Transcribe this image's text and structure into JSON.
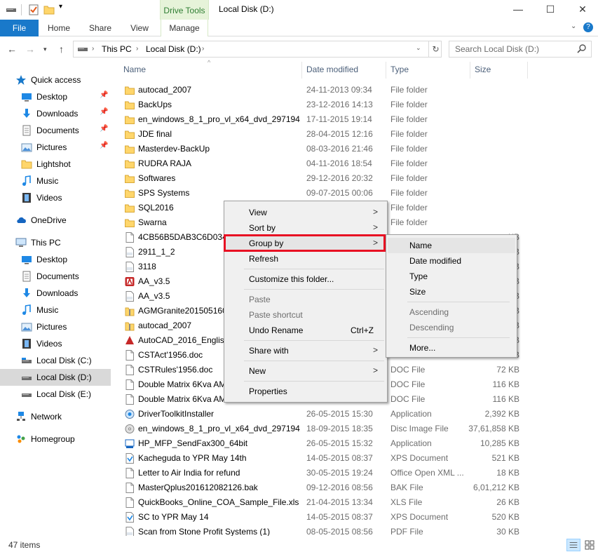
{
  "title_bar": {
    "contextual_tab": "Drive Tools",
    "window_title": "Local Disk (D:)",
    "minimize": "—",
    "maximize": "☐",
    "close": "✕"
  },
  "ribbon": {
    "tabs": [
      {
        "label": "File"
      },
      {
        "label": "Home"
      },
      {
        "label": "Share"
      },
      {
        "label": "View"
      },
      {
        "label": "Manage"
      }
    ],
    "help": "?"
  },
  "address_bar": {
    "crumbs": [
      "This PC",
      "Local Disk (D:)"
    ],
    "search_placeholder": "Search Local Disk (D:)"
  },
  "nav_pane": {
    "items": [
      {
        "label": "Quick access",
        "icon": "star-icon"
      },
      {
        "label": "Desktop",
        "icon": "desktop-icon",
        "pinned": true
      },
      {
        "label": "Downloads",
        "icon": "downloads-icon",
        "pinned": true
      },
      {
        "label": "Documents",
        "icon": "documents-icon",
        "pinned": true
      },
      {
        "label": "Pictures",
        "icon": "pictures-icon",
        "pinned": true
      },
      {
        "label": "Lightshot",
        "icon": "folder-icon"
      },
      {
        "label": "Music",
        "icon": "music-icon"
      },
      {
        "label": "Videos",
        "icon": "videos-icon"
      },
      {
        "label": "OneDrive",
        "icon": "cloud-icon"
      },
      {
        "label": "This PC",
        "icon": "computer-icon"
      },
      {
        "label": "Desktop",
        "icon": "desktop-icon"
      },
      {
        "label": "Documents",
        "icon": "documents-icon"
      },
      {
        "label": "Downloads",
        "icon": "downloads-icon"
      },
      {
        "label": "Music",
        "icon": "music-icon"
      },
      {
        "label": "Pictures",
        "icon": "pictures-icon"
      },
      {
        "label": "Videos",
        "icon": "videos-icon"
      },
      {
        "label": "Local Disk (C:)",
        "icon": "drive-icon"
      },
      {
        "label": "Local Disk (D:)",
        "icon": "drive-icon",
        "selected": true
      },
      {
        "label": "Local Disk (E:)",
        "icon": "drive-icon"
      },
      {
        "label": "Network",
        "icon": "network-icon"
      },
      {
        "label": "Homegroup",
        "icon": "homegroup-icon"
      }
    ]
  },
  "columns": {
    "name": "Name",
    "date": "Date modified",
    "type": "Type",
    "size": "Size"
  },
  "files": [
    {
      "name": "autocad_2007",
      "date": "24-11-2013 09:34",
      "type": "File folder",
      "size": "",
      "icon": "folder-icon"
    },
    {
      "name": "BackUps",
      "date": "23-12-2016 14:13",
      "type": "File folder",
      "size": "",
      "icon": "folder-icon"
    },
    {
      "name": "en_windows_8_1_pro_vl_x64_dvd_297194...",
      "date": "17-11-2015 19:14",
      "type": "File folder",
      "size": "",
      "icon": "folder-icon"
    },
    {
      "name": "JDE final",
      "date": "28-04-2015 12:16",
      "type": "File folder",
      "size": "",
      "icon": "folder-icon"
    },
    {
      "name": "Masterdev-BackUp",
      "date": "08-03-2016 21:46",
      "type": "File folder",
      "size": "",
      "icon": "folder-icon"
    },
    {
      "name": "RUDRA RAJA",
      "date": "04-11-2016 18:54",
      "type": "File folder",
      "size": "",
      "icon": "folder-icon"
    },
    {
      "name": "Softwares",
      "date": "29-12-2016 20:32",
      "type": "File folder",
      "size": "",
      "icon": "folder-icon"
    },
    {
      "name": "SPS Systems",
      "date": "09-07-2015 00:06",
      "type": "File folder",
      "size": "",
      "icon": "folder-icon"
    },
    {
      "name": "SQL2016",
      "date": "",
      "type": "File folder",
      "size": "",
      "icon": "folder-icon"
    },
    {
      "name": "Swarna",
      "date": "",
      "type": "File folder",
      "size": "",
      "icon": "folder-icon"
    },
    {
      "name": "4CB56B5DAB3C6D0340",
      "date": "",
      "type": "",
      "size": "KB",
      "icon": "file-icon"
    },
    {
      "name": "2911_1_2",
      "date": "",
      "type": "",
      "size": "KB",
      "icon": "pdf-icon"
    },
    {
      "name": "3118",
      "date": "",
      "type": "",
      "size": "KB",
      "icon": "pdf-icon"
    },
    {
      "name": "AA_v3.5",
      "date": "",
      "type": "",
      "size": "KB",
      "icon": "app-red-icon"
    },
    {
      "name": "AA_v3.5",
      "date": "",
      "type": "",
      "size": "KB",
      "icon": "pdf-icon"
    },
    {
      "name": "AGMGranite20150516001",
      "date": "",
      "type": "",
      "size": "KB",
      "icon": "zip-icon"
    },
    {
      "name": "autocad_2007",
      "date": "",
      "type": "",
      "size": "KB",
      "icon": "zip-icon"
    },
    {
      "name": "AutoCAD_2016_English_",
      "date": "",
      "type": "",
      "size": "KB",
      "icon": "autocad-icon"
    },
    {
      "name": "CSTAct'1956.doc",
      "date": "",
      "type": "",
      "size": "KB",
      "icon": "file-icon"
    },
    {
      "name": "CSTRules'1956.doc",
      "date": "",
      "type": "DOC File",
      "size": "72 KB",
      "icon": "file-icon"
    },
    {
      "name": "Double Matrix  6Kva AMC",
      "date": "",
      "type": "DOC File",
      "size": "116 KB",
      "icon": "file-icon"
    },
    {
      "name": "Double Matrix  6Kva AMC",
      "date": "",
      "type": "DOC File",
      "size": "116 KB",
      "icon": "file-icon"
    },
    {
      "name": "DriverToolkitInstaller",
      "date": "26-05-2015 15:30",
      "type": "Application",
      "size": "2,392 KB",
      "icon": "installer-icon"
    },
    {
      "name": "en_windows_8_1_pro_vl_x64_dvd_297194...",
      "date": "18-09-2015 18:35",
      "type": "Disc Image File",
      "size": "37,61,858 KB",
      "icon": "disc-icon"
    },
    {
      "name": "HP_MFP_SendFax300_64bit",
      "date": "26-05-2015 15:32",
      "type": "Application",
      "size": "10,285 KB",
      "icon": "hp-icon"
    },
    {
      "name": "Kacheguda to YPR May 14th",
      "date": "14-05-2015 08:37",
      "type": "XPS Document",
      "size": "521 KB",
      "icon": "xps-icon"
    },
    {
      "name": "Letter to Air India for refund",
      "date": "30-05-2015 19:24",
      "type": "Office Open XML ...",
      "size": "18 KB",
      "icon": "file-icon"
    },
    {
      "name": "MasterQplus201612082126.bak",
      "date": "09-12-2016 08:56",
      "type": "BAK File",
      "size": "6,01,212 KB",
      "icon": "file-icon"
    },
    {
      "name": "QuickBooks_Online_COA_Sample_File.xls",
      "date": "21-04-2015 13:34",
      "type": "XLS File",
      "size": "26 KB",
      "icon": "file-icon"
    },
    {
      "name": "SC to YPR May 14",
      "date": "14-05-2015 08:37",
      "type": "XPS Document",
      "size": "520 KB",
      "icon": "xps-icon"
    },
    {
      "name": "Scan from Stone Profit Systems (1)",
      "date": "08-05-2015 08:56",
      "type": "PDF File",
      "size": "30 KB",
      "icon": "pdf-icon"
    }
  ],
  "context_menu": {
    "view": "View",
    "sort_by": "Sort by",
    "group_by": "Group by",
    "refresh": "Refresh",
    "customize": "Customize this folder...",
    "paste": "Paste",
    "paste_shortcut": "Paste shortcut",
    "undo_rename": "Undo Rename",
    "undo_shortcut": "Ctrl+Z",
    "share_with": "Share with",
    "new": "New",
    "properties": "Properties",
    "arrow": ">"
  },
  "submenu": {
    "name": "Name",
    "date_modified": "Date modified",
    "type": "Type",
    "size": "Size",
    "ascending": "Ascending",
    "descending": "Descending",
    "more": "More..."
  },
  "status_bar": {
    "count": "47 items"
  },
  "colors": {
    "file_tab": "#1979ca",
    "drive_tools_bg": "#e6f3d9",
    "folder": "#ffd66b",
    "highlight_box": "#e81123",
    "selected_nav": "#d9d9d9"
  }
}
